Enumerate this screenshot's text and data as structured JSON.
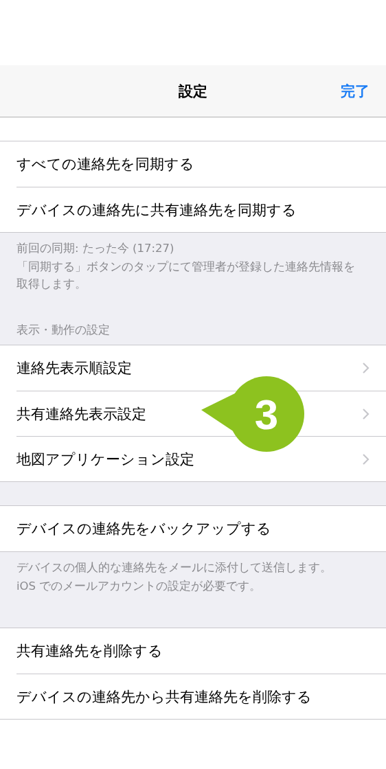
{
  "nav": {
    "title": "設定",
    "done": "完了"
  },
  "sections": [
    {
      "kind": "group",
      "rows": [
        {
          "label": "すべての連絡先を同期する",
          "disclosure": false
        },
        {
          "label": "デバイスの連絡先に共有連絡先を同期する",
          "disclosure": false
        }
      ]
    },
    {
      "kind": "note",
      "lines": [
        "前回の同期: たった今 (17:27)",
        "「同期する」ボタンのタップにて管理者が登録した連絡先情報を取得します。"
      ]
    },
    {
      "kind": "header",
      "text": "表示・動作の設定"
    },
    {
      "kind": "group",
      "rows": [
        {
          "label": "連絡先表示順設定",
          "disclosure": true
        },
        {
          "label": "共有連絡先表示設定",
          "disclosure": true,
          "callout": "3"
        },
        {
          "label": "地図アプリケーション設定",
          "disclosure": true
        }
      ]
    },
    {
      "kind": "group",
      "rows": [
        {
          "label": "デバイスの連絡先をバックアップする",
          "disclosure": false
        }
      ]
    },
    {
      "kind": "note",
      "lines": [
        "デバイスの個人的な連絡先をメールに添付して送信します。",
        "iOS でのメールアカウントの設定が必要です。"
      ]
    },
    {
      "kind": "group",
      "rows": [
        {
          "label": "共有連絡先を削除する",
          "disclosure": false
        },
        {
          "label": "デバイスの連絡先から共有連絡先を削除する",
          "disclosure": false
        }
      ]
    }
  ]
}
